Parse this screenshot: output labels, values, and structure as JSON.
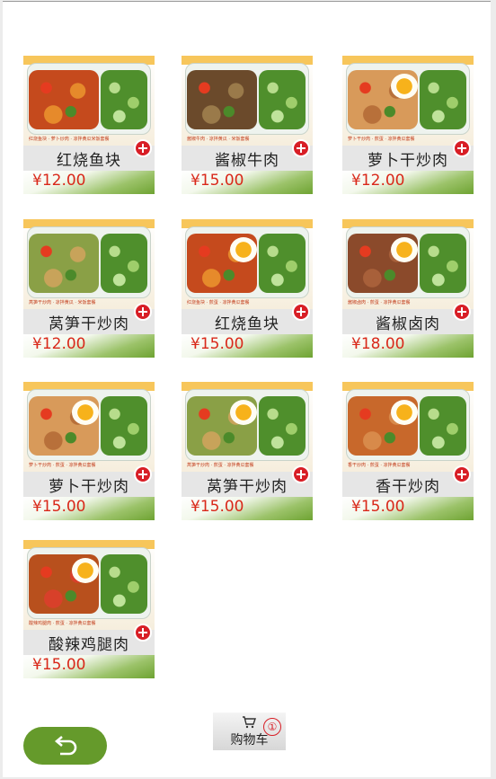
{
  "menu": {
    "items": [
      {
        "name": "红烧鱼块",
        "price": "¥12.00",
        "caption": "红烧鱼块 · 萝卜炒肉 · 凉拌黄瓜米饭套餐",
        "main_colors": [
          "#c54a1d",
          "#e68a2b"
        ],
        "egg": false
      },
      {
        "name": "酱椒牛肉",
        "price": "¥15.00",
        "caption": "酱椒牛肉 · 凉拌黄瓜 · 米饭套餐",
        "main_colors": [
          "#6b4a2b",
          "#9a7a4a"
        ],
        "egg": false
      },
      {
        "name": "萝卜干炒肉",
        "price": "¥12.00",
        "caption": "萝卜干炒肉 · 煎蛋 · 凉拌黄瓜套餐",
        "main_colors": [
          "#d89a5a",
          "#b8703a"
        ],
        "egg": true
      },
      {
        "name": "莴笋干炒肉",
        "price": "¥12.00",
        "caption": "莴笋干炒肉 · 凉拌黄瓜 · 米饭套餐",
        "main_colors": [
          "#8aa046",
          "#c8a35a"
        ],
        "egg": false
      },
      {
        "name": "红烧鱼块",
        "price": "¥15.00",
        "caption": "红烧鱼块 · 煎蛋 · 凉拌黄瓜套餐",
        "main_colors": [
          "#c54a1d",
          "#e68a2b"
        ],
        "egg": true
      },
      {
        "name": "酱椒卤肉",
        "price": "¥18.00",
        "caption": "酱椒卤肉 · 煎蛋 · 凉拌黄瓜套餐",
        "main_colors": [
          "#8b4a2b",
          "#a8603a"
        ],
        "egg": true
      },
      {
        "name": "萝卜干炒肉",
        "price": "¥15.00",
        "caption": "萝卜干炒肉 · 煎蛋 · 凉拌黄瓜套餐",
        "main_colors": [
          "#d89a5a",
          "#b8703a"
        ],
        "egg": true
      },
      {
        "name": "莴笋干炒肉",
        "price": "¥15.00",
        "caption": "莴笋干炒肉 · 煎蛋 · 凉拌黄瓜套餐",
        "main_colors": [
          "#8aa046",
          "#c8a35a"
        ],
        "egg": true
      },
      {
        "name": "香干炒肉",
        "price": "¥15.00",
        "caption": "香干炒肉 · 煎蛋 · 凉拌黄瓜套餐",
        "main_colors": [
          "#c8682b",
          "#d88a4a"
        ],
        "egg": true
      },
      {
        "name": "酸辣鸡腿肉",
        "price": "¥15.00",
        "caption": "酸辣鸡腿肉 · 煎蛋 · 凉拌黄瓜套餐",
        "main_colors": [
          "#b8501d",
          "#d8402a"
        ],
        "egg": true
      }
    ]
  },
  "cart": {
    "label": "购物车",
    "count": "①",
    "icon": "cart-icon"
  },
  "back_button": {
    "icon": "return-arrow-icon"
  },
  "colors": {
    "price": "#d9281a",
    "add_button": "#d81e26",
    "back_button": "#659a2b",
    "price_strip_green": "#6ea332"
  }
}
